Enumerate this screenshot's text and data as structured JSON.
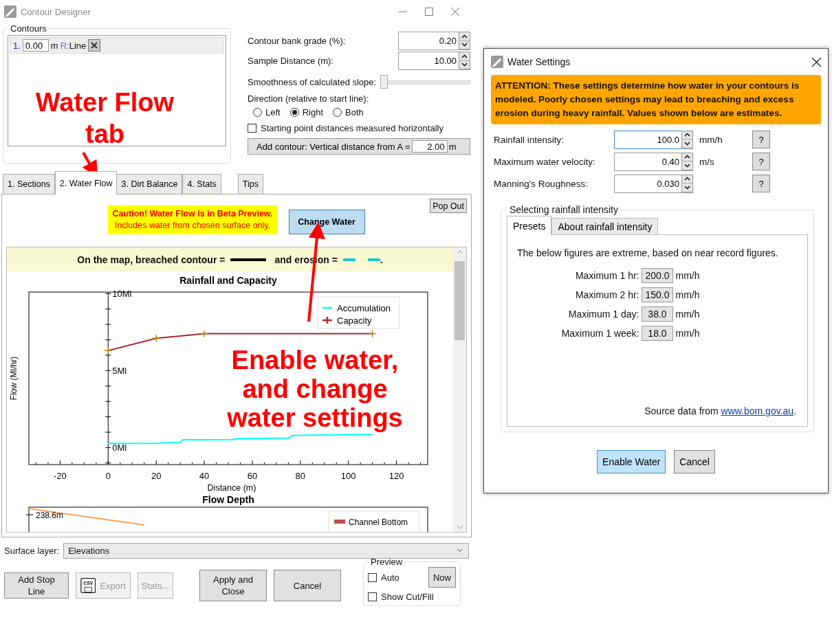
{
  "window": {
    "title": "Contour Designer"
  },
  "contours": {
    "title": "Contours",
    "items": [
      {
        "number": "1.",
        "value": "0.00",
        "unit": "m",
        "prefix": "R:",
        "name": "Line"
      }
    ]
  },
  "settings": {
    "bank_grade": {
      "label": "Contour bank grade (%):",
      "value": "0.20"
    },
    "sample_distance": {
      "label": "Sample Distance (m):",
      "value": "10.00"
    },
    "smoothness": {
      "label": "Smoothness of calculated slope:",
      "level": 0
    },
    "direction": {
      "label": "Direction (relative to start line):",
      "options": [
        {
          "label": "Left",
          "selected": false
        },
        {
          "label": "Right",
          "selected": true
        },
        {
          "label": "Both",
          "selected": false
        }
      ]
    },
    "horizontal": {
      "label": "Starting point distances measured horizontally",
      "checked": false
    },
    "add_contour": {
      "label": "Add contour: Vertical distance from A =",
      "value": "2.00",
      "unit": "m"
    }
  },
  "tabs": [
    {
      "label": "1. Sections",
      "selected": false
    },
    {
      "label": "2. Water Flow",
      "selected": true
    },
    {
      "label": "3. Dirt Balance",
      "selected": false
    },
    {
      "label": "4. Stats",
      "selected": false
    }
  ],
  "tips_tab": {
    "label": "Tips",
    "selected": false
  },
  "water_flow": {
    "caution": {
      "title": "Caution! Water Flow is in Beta Preview.",
      "note": "Includes water from chosen surface only."
    },
    "change_water": "Change Water",
    "pop_out": "Pop Out",
    "legend_note": {
      "breached": "On the map, breached contour =",
      "erosion": "and erosion =",
      "end": "."
    },
    "chart_data": {
      "type": "line",
      "legend": true,
      "title": "Rainfall and Capacity",
      "xlabel": "Distance (m)",
      "ylabel": "Flow (Ml/hr)",
      "xlim": [
        -33,
        133
      ],
      "ylim": [
        -1.1,
        10.1
      ],
      "xticks": [
        -20,
        0,
        20,
        40,
        60,
        80,
        100,
        120
      ],
      "yticks": [
        {
          "value": 0,
          "label": "0Ml"
        },
        {
          "value": 5,
          "label": "5Ml"
        },
        {
          "value": 10,
          "label": "10Ml"
        }
      ],
      "x": [
        0,
        10,
        20,
        30,
        31,
        40,
        52,
        53,
        60,
        75,
        77,
        80,
        90,
        100,
        110
      ],
      "series": [
        {
          "name": "Accumulation",
          "color": "#00ffff",
          "values": [
            0.27,
            0.27,
            0.28,
            0.35,
            0.5,
            0.5,
            0.52,
            0.58,
            0.6,
            0.62,
            0.8,
            0.8,
            0.82,
            0.84,
            0.85
          ]
        },
        {
          "name": "Capacity",
          "color": "#a52a2a",
          "values": [
            6.3,
            null,
            7.1,
            null,
            null,
            7.4,
            null,
            null,
            null,
            null,
            null,
            null,
            null,
            null,
            7.4
          ]
        }
      ]
    },
    "flow_depth": {
      "title": "Flow Depth",
      "tick": "238.6m",
      "legend": "Channel Bottom"
    }
  },
  "surface_layer": {
    "label": "Surface layer:",
    "value": "Elevations"
  },
  "buttons": {
    "add_stop_line": {
      "label": "Add Stop Line",
      "disabled": false
    },
    "export": {
      "label": "Export",
      "icon_text": "CSV",
      "disabled": true
    },
    "stats": {
      "label": "Stats...",
      "disabled": true
    },
    "apply": {
      "label": "Apply and Close",
      "disabled": false
    },
    "cancel": {
      "label": "Cancel",
      "disabled": false
    }
  },
  "preview": {
    "title": "Preview",
    "auto": {
      "label": "Auto",
      "checked": false
    },
    "now": "Now",
    "show_cut_fill": {
      "label": "Show Cut/Fill",
      "checked": false
    }
  },
  "dialog": {
    "title": "Water Settings",
    "attention": "ATTENTION: These settings determine how water in your contours is modeled. Poorly chosen settings may lead to breaching and excess erosion during heavy rainfall. Values shown below are estimates.",
    "fields": [
      {
        "label": "Rainfall intensity:",
        "value": "100.0",
        "unit": "mm/h",
        "selected": true,
        "help": "?"
      },
      {
        "label": "Maximum water velocity:",
        "value": "0.40",
        "unit": "m/s",
        "selected": false,
        "help": "?"
      },
      {
        "label": "Manning's Roughness:",
        "value": "0.030",
        "selected": false,
        "help": "?"
      }
    ],
    "group_title": "Selecting rainfall intensity",
    "tabs": [
      {
        "label": "Presets",
        "selected": true
      },
      {
        "label": "About rainfall intensity",
        "selected": false
      }
    ],
    "intro": "The below figures are extreme, based on near record figures.",
    "presets": [
      {
        "label": "Maximum 1 hr:",
        "value": "200.0",
        "unit": "mm/h"
      },
      {
        "label": "Maximum 2 hr:",
        "value": "150.0",
        "unit": "mm/h"
      },
      {
        "label": "Maximum 1 day:",
        "value": "38.0",
        "unit": "mm/h"
      },
      {
        "label": "Maximum 1 week:",
        "value": "18.0",
        "unit": "mm/h"
      }
    ],
    "source": {
      "text": "Source data from",
      "link": "www.bom.gov.au",
      "end": "."
    },
    "buttons": [
      {
        "label": "Enable Water",
        "kind": "primary"
      },
      {
        "label": "Cancel",
        "kind": "normal"
      }
    ]
  },
  "annotations": [
    {
      "text": "Water Flow tab"
    },
    {
      "text": "Enable water, and change water settings"
    }
  ]
}
